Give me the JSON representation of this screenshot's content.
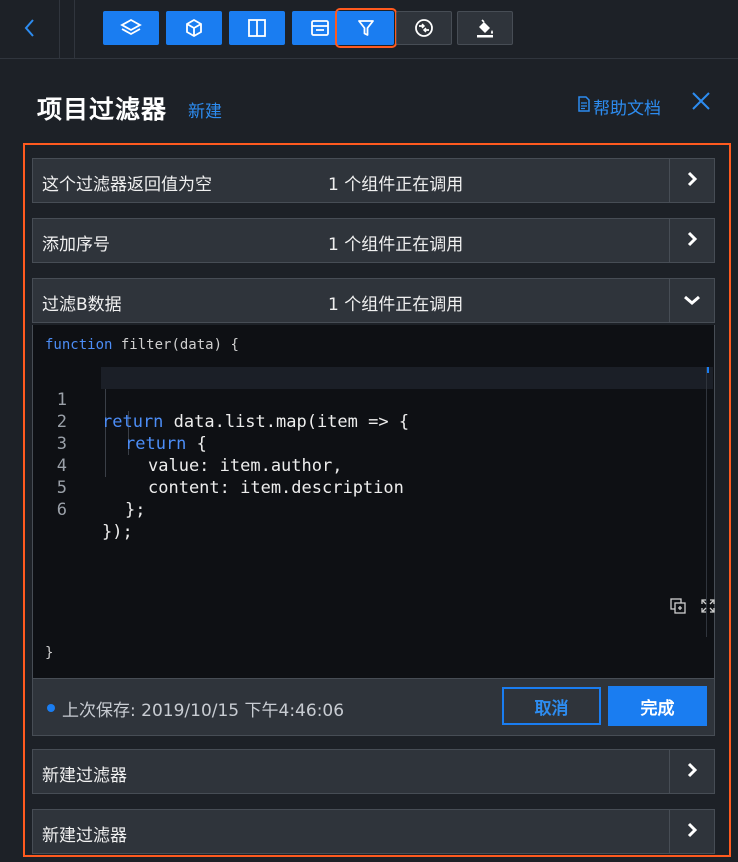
{
  "toolbar": {
    "back_icon": "chevron-left-icon",
    "buttons": [
      {
        "icon": "layers-icon",
        "state": "normal"
      },
      {
        "icon": "cube-icon",
        "state": "normal"
      },
      {
        "icon": "columns-icon",
        "state": "normal"
      },
      {
        "icon": "card-icon",
        "state": "normal"
      },
      {
        "icon": "filter-icon",
        "state": "active"
      },
      {
        "icon": "sync-icon",
        "state": "dark"
      },
      {
        "icon": "paint-bucket-icon",
        "state": "dark"
      }
    ]
  },
  "header": {
    "title": "项目过滤器",
    "new_label": "新建",
    "help_label": "帮助文档"
  },
  "filters": [
    {
      "name": "这个过滤器返回值为空",
      "usage": "1 个组件正在调用",
      "expanded": false
    },
    {
      "name": "添加序号",
      "usage": "1 个组件正在调用",
      "expanded": false
    },
    {
      "name": "过滤B数据",
      "usage": "1 个组件正在调用",
      "expanded": true
    },
    {
      "name": "新建过滤器",
      "usage": "",
      "expanded": false
    },
    {
      "name": "新建过滤器",
      "usage": "",
      "expanded": false
    }
  ],
  "editor": {
    "fn_keyword": "function",
    "fn_signature": " filter(data) {",
    "fn_close": "}",
    "line_numbers": [
      "1",
      "2",
      "3",
      "4",
      "5",
      "6"
    ],
    "lines": [
      {
        "kw": "return",
        "rest": " data.list.map(item => {"
      },
      {
        "kw": "return",
        "rest": " {"
      },
      {
        "kw": "",
        "rest": "value: item.author,"
      },
      {
        "kw": "",
        "rest": "content: item.description"
      },
      {
        "kw": "",
        "rest": "};"
      },
      {
        "kw": "",
        "rest": "});"
      }
    ]
  },
  "save": {
    "last_saved": "上次保存: 2019/10/15 下午4:46:06",
    "cancel_label": "取消",
    "done_label": "完成"
  },
  "colors": {
    "accent": "#1a7df1",
    "highlight_border": "#ff5a1f",
    "background": "#1d2127"
  }
}
